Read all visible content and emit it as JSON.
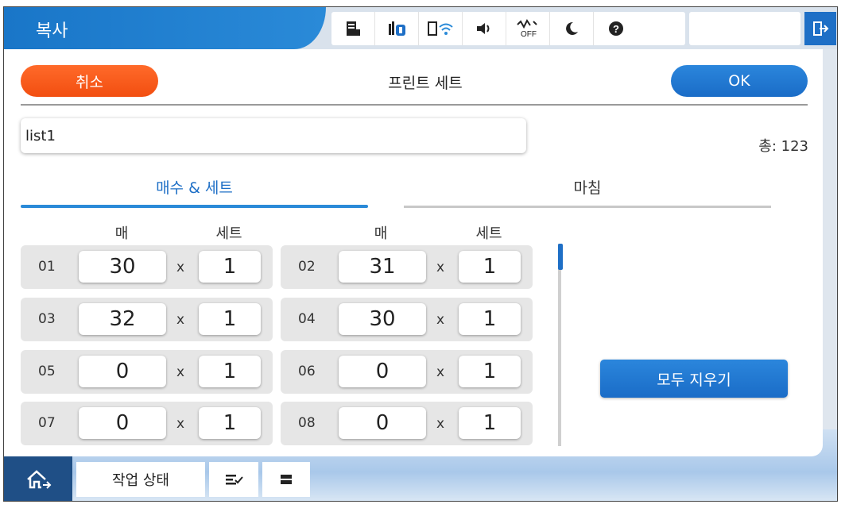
{
  "app": {
    "title": "복사"
  },
  "status_icons": [
    "document-icon",
    "ink-icon",
    "wifi-icon",
    "sound-icon",
    "signal-off-icon",
    "sleep-icon",
    "help-icon"
  ],
  "status_off_label": "OFF",
  "toolbar": {
    "cancel_label": "취소",
    "title": "프린트 세트",
    "ok_label": "OK"
  },
  "list_name": {
    "value": "list1"
  },
  "total": {
    "label": "총: 123"
  },
  "tabs": [
    {
      "label": "매수 & 세트",
      "active": true
    },
    {
      "label": "마침",
      "active": false
    }
  ],
  "columns": {
    "copies": "매",
    "sets": "세트"
  },
  "times_symbol": "x",
  "rows": [
    {
      "num": "01",
      "copies": "30",
      "sets": "1"
    },
    {
      "num": "02",
      "copies": "31",
      "sets": "1"
    },
    {
      "num": "03",
      "copies": "32",
      "sets": "1"
    },
    {
      "num": "04",
      "copies": "30",
      "sets": "1"
    },
    {
      "num": "05",
      "copies": "0",
      "sets": "1"
    },
    {
      "num": "06",
      "copies": "0",
      "sets": "1"
    },
    {
      "num": "07",
      "copies": "0",
      "sets": "1"
    },
    {
      "num": "08",
      "copies": "0",
      "sets": "1"
    }
  ],
  "clear_all_label": "모두 지우기",
  "bottom": {
    "job_status_label": "작업 상태"
  },
  "colors": {
    "accent": "#1e6fc6",
    "cancel": "#f24e10",
    "header": "#1976c8"
  }
}
